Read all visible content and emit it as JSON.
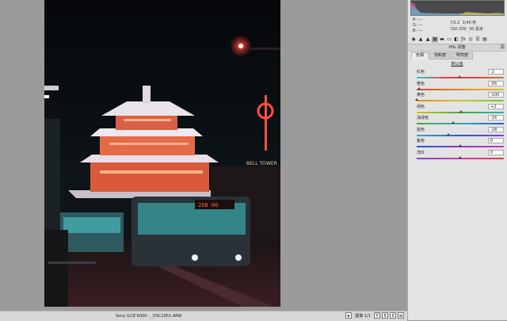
{
  "status": {
    "filename": "Sony ILCE-6000 - _DSC2951.ARW",
    "page": "图像 1/1",
    "buttons": [
      "Y",
      "⇕",
      "⇕",
      "≡"
    ]
  },
  "readout": {
    "r_label": "R:",
    "r_value": "---",
    "g_label": "G:",
    "g_value": "---",
    "b_label": "B:",
    "b_value": "---",
    "aperture": "f/2.2",
    "shutter": "1/40 秒",
    "iso": "ISO 200",
    "focal": "30 毫米"
  },
  "toolbar": {
    "icons": [
      "aperture-icon",
      "tone-curve-icon",
      "mountain-icon",
      "hsl-icon",
      "split-tone-icon",
      "detail-icon",
      "lens-icon",
      "fx-icon",
      "camera-calibration-icon",
      "presets-icon",
      "snapshots-icon"
    ],
    "glyphs": [
      "◉",
      "▲",
      "▲",
      "▦",
      "▬",
      "▭",
      "◧",
      "ƒx",
      "◎",
      "☰",
      "▤"
    ],
    "active_index": 3
  },
  "panel": {
    "title": "HSL 调整",
    "tabs": [
      "色相",
      "饱和度",
      "明亮度"
    ],
    "active_tab": 0,
    "section_link": "默认值"
  },
  "sliders": [
    {
      "label": "红色",
      "value": "-2",
      "position": 0.49
    },
    {
      "label": "橙色",
      "value": "-95",
      "position": 0.025
    },
    {
      "label": "黄色",
      "value": "-100",
      "position": 0.0
    },
    {
      "label": "绿色",
      "value": "+2",
      "position": 0.51
    },
    {
      "label": "浅绿色",
      "value": "-16",
      "position": 0.42
    },
    {
      "label": "蓝色",
      "value": "-28",
      "position": 0.36
    },
    {
      "label": "紫色",
      "value": "0",
      "position": 0.5
    },
    {
      "label": "洋红",
      "value": "0",
      "position": 0.5
    }
  ],
  "colors": {
    "red_track": "#e04040",
    "orange_track": "#e08a2a",
    "yellow_track": "#d6c42a",
    "green_track": "#4aa83a",
    "aqua_track": "#2ab0b0",
    "blue_track": "#2a5ad8",
    "purple_track": "#8a3ad0",
    "magenta_track": "#d03ab0"
  }
}
